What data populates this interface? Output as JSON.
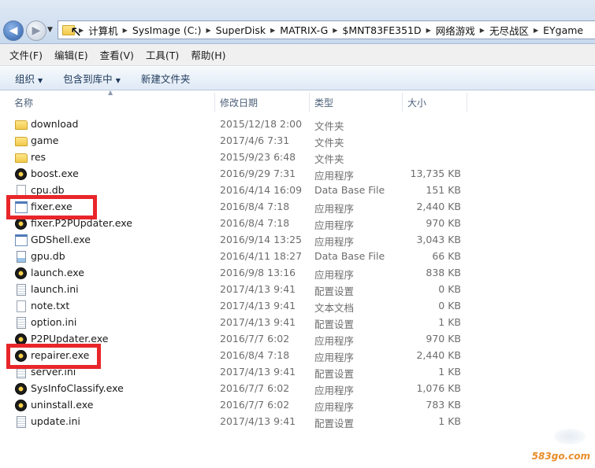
{
  "address": {
    "crumbs": [
      "计算机",
      "SysImage (C:)",
      "SuperDisk",
      "MATRIX-G",
      "$MNT83FE351D",
      "网络游戏",
      "无尽战区",
      "EYgame"
    ]
  },
  "menu": [
    "文件(F)",
    "编辑(E)",
    "查看(V)",
    "工具(T)",
    "帮助(H)"
  ],
  "toolbar": {
    "organize": "组织",
    "include": "包含到库中",
    "new_folder": "新建文件夹"
  },
  "columns": {
    "name": "名称",
    "date": "修改日期",
    "type": "类型",
    "size": "大小"
  },
  "files": [
    {
      "name": "download",
      "date": "2015/12/18 2:00",
      "type": "文件夹",
      "size": "",
      "icon": "folder-icon"
    },
    {
      "name": "game",
      "date": "2017/4/6 7:31",
      "type": "文件夹",
      "size": "",
      "icon": "folder-icon"
    },
    {
      "name": "res",
      "date": "2015/9/23 6:48",
      "type": "文件夹",
      "size": "",
      "icon": "folder-icon"
    },
    {
      "name": "boost.exe",
      "date": "2016/9/29 7:31",
      "type": "应用程序",
      "size": "13,735 KB",
      "icon": "app-icon"
    },
    {
      "name": "cpu.db",
      "date": "2016/4/14 16:09",
      "type": "Data Base File",
      "size": "151 KB",
      "icon": "document-icon"
    },
    {
      "name": "fixer.exe",
      "date": "2016/8/4 7:18",
      "type": "应用程序",
      "size": "2,440 KB",
      "icon": "window-app-icon"
    },
    {
      "name": "fixer.P2PUpdater.exe",
      "date": "2016/8/4 7:18",
      "type": "应用程序",
      "size": "970 KB",
      "icon": "app-icon"
    },
    {
      "name": "GDShell.exe",
      "date": "2016/9/14 13:25",
      "type": "应用程序",
      "size": "3,043 KB",
      "icon": "window-app-icon"
    },
    {
      "name": "gpu.db",
      "date": "2016/4/11 18:27",
      "type": "Data Base File",
      "size": "66 KB",
      "icon": "database-icon"
    },
    {
      "name": "launch.exe",
      "date": "2016/9/8 13:16",
      "type": "应用程序",
      "size": "838 KB",
      "icon": "app-icon"
    },
    {
      "name": "launch.ini",
      "date": "2017/4/13 9:41",
      "type": "配置设置",
      "size": "0 KB",
      "icon": "settings-file-icon"
    },
    {
      "name": "note.txt",
      "date": "2017/4/13 9:41",
      "type": "文本文档",
      "size": "0 KB",
      "icon": "document-icon"
    },
    {
      "name": "option.ini",
      "date": "2017/4/13 9:41",
      "type": "配置设置",
      "size": "1 KB",
      "icon": "settings-file-icon"
    },
    {
      "name": "P2PUpdater.exe",
      "date": "2016/7/7 6:02",
      "type": "应用程序",
      "size": "970 KB",
      "icon": "app-icon"
    },
    {
      "name": "repairer.exe",
      "date": "2016/8/4 7:18",
      "type": "应用程序",
      "size": "2,440 KB",
      "icon": "app-icon"
    },
    {
      "name": "server.ini",
      "date": "2017/4/13 9:41",
      "type": "配置设置",
      "size": "1 KB",
      "icon": "settings-file-icon"
    },
    {
      "name": "SysInfoClassify.exe",
      "date": "2016/7/7 6:02",
      "type": "应用程序",
      "size": "1,076 KB",
      "icon": "app-icon"
    },
    {
      "name": "uninstall.exe",
      "date": "2016/7/7 6:02",
      "type": "应用程序",
      "size": "783 KB",
      "icon": "app-icon"
    },
    {
      "name": "update.ini",
      "date": "2017/4/13 9:41",
      "type": "配置设置",
      "size": "1 KB",
      "icon": "settings-file-icon"
    }
  ],
  "highlight_color": "#e8262a",
  "watermark": "583go.com"
}
